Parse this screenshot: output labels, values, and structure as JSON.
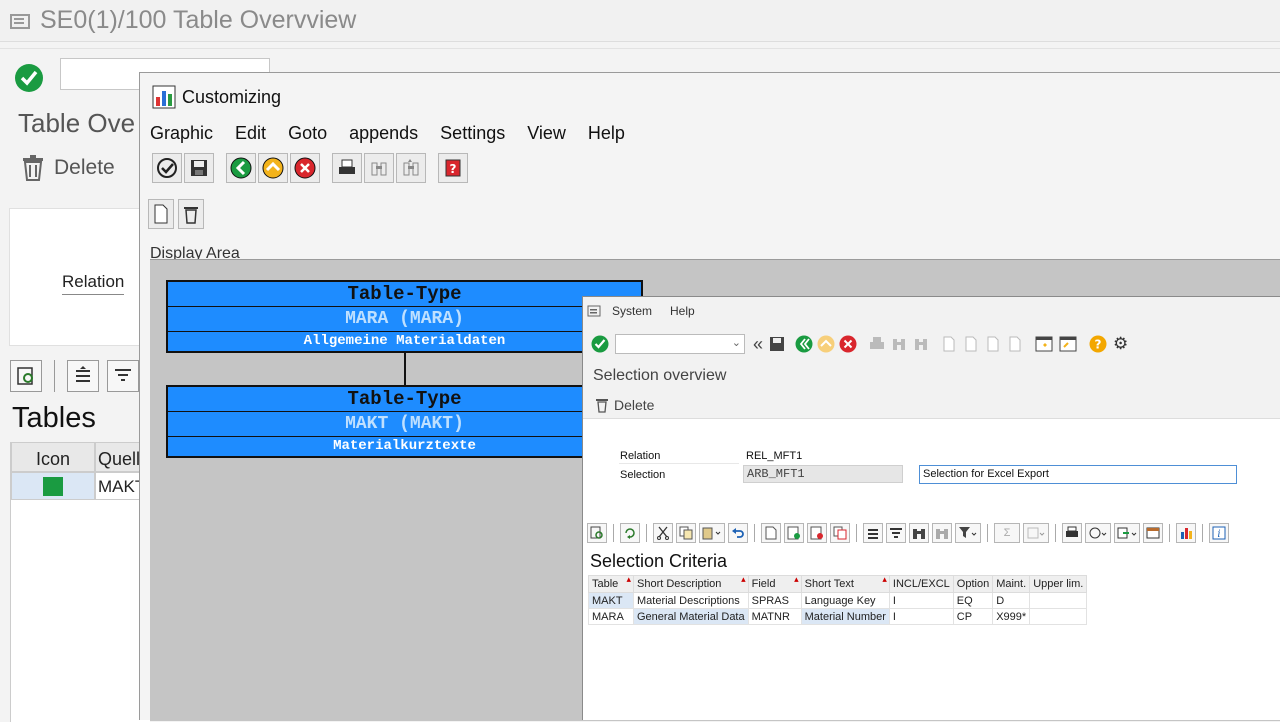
{
  "background_window": {
    "title": "SE0(1)/100 Table Overvview",
    "heading": "Table Ove",
    "delete_label": "Delete",
    "relation_label": "Relation",
    "tables_heading": "Tables",
    "grid_headers": [
      "Icon",
      "Quell-"
    ],
    "grid_row": {
      "icon_color": "#1a9b41",
      "value": "MAKT"
    }
  },
  "customizing": {
    "title": "Customizing",
    "menu": [
      "Graphic",
      "Edit",
      "Goto",
      "appends",
      "Settings",
      "View",
      "Help"
    ],
    "display_area_label": "Display Area",
    "boxes": [
      {
        "type": "Table-Type",
        "name": "MARA (MARA)",
        "description": "Allgemeine Materialdaten"
      },
      {
        "type": "Table-Type",
        "name": "MAKT (MAKT)",
        "description": "Materialkurztexte"
      }
    ]
  },
  "selection_window": {
    "menu": [
      "System",
      "Help"
    ],
    "title": "Selection overview",
    "delete_label": "Delete",
    "relation_label": "Relation",
    "relation_value": "REL_MFT1",
    "selection_label": "Selection",
    "selection_value": "ARB_MFT1",
    "selection_description": "Selection for Excel Export",
    "criteria_title": "Selection Criteria",
    "columns": [
      "Table",
      "Short Description",
      "Field",
      "Short Text",
      "INCL/EXCL",
      "Option",
      "Maint.",
      "Upper lim."
    ],
    "rows": [
      [
        "MAKT",
        "Material Descriptions",
        "SPRAS",
        "Language Key",
        "I",
        "EQ",
        "D",
        ""
      ],
      [
        "MARA",
        "General Material Data",
        "MATNR",
        "Material Number",
        "I",
        "CP",
        "X999*",
        ""
      ]
    ]
  },
  "colors": {
    "accent": "#1e8cff",
    "ok_green": "#1a9b41",
    "cancel_red": "#d9262d",
    "display_gray": "#c5c5c5"
  }
}
